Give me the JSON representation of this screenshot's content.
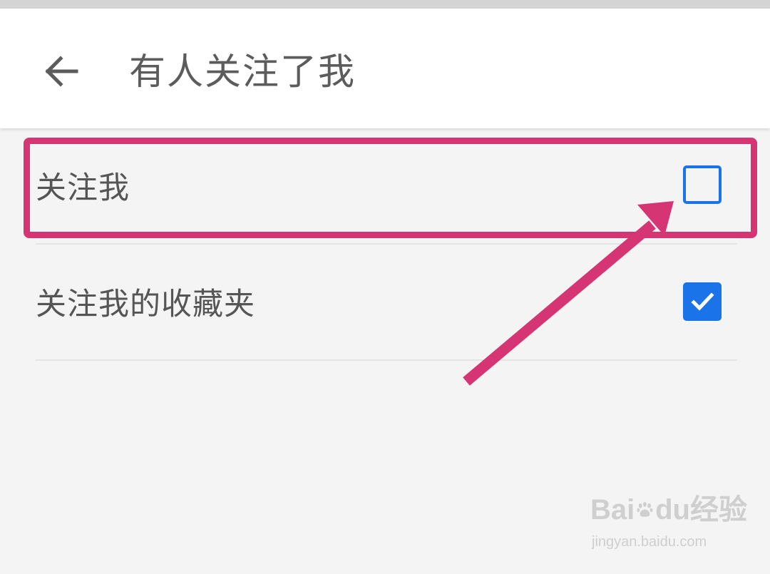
{
  "header": {
    "back_icon": "arrow-left-icon",
    "title": "有人关注了我"
  },
  "settings": {
    "items": [
      {
        "label": "关注我",
        "checked": false
      },
      {
        "label": "关注我的收藏夹",
        "checked": true
      }
    ]
  },
  "watermark": {
    "brand_left": "Bai",
    "brand_right": "du",
    "brand_suffix": "经验",
    "url": "jingyan.baidu.com"
  },
  "colors": {
    "accent": "#1a73e8",
    "highlight": "#d63574",
    "title_text": "#5c5c5c",
    "background": "#f4f4f4"
  }
}
